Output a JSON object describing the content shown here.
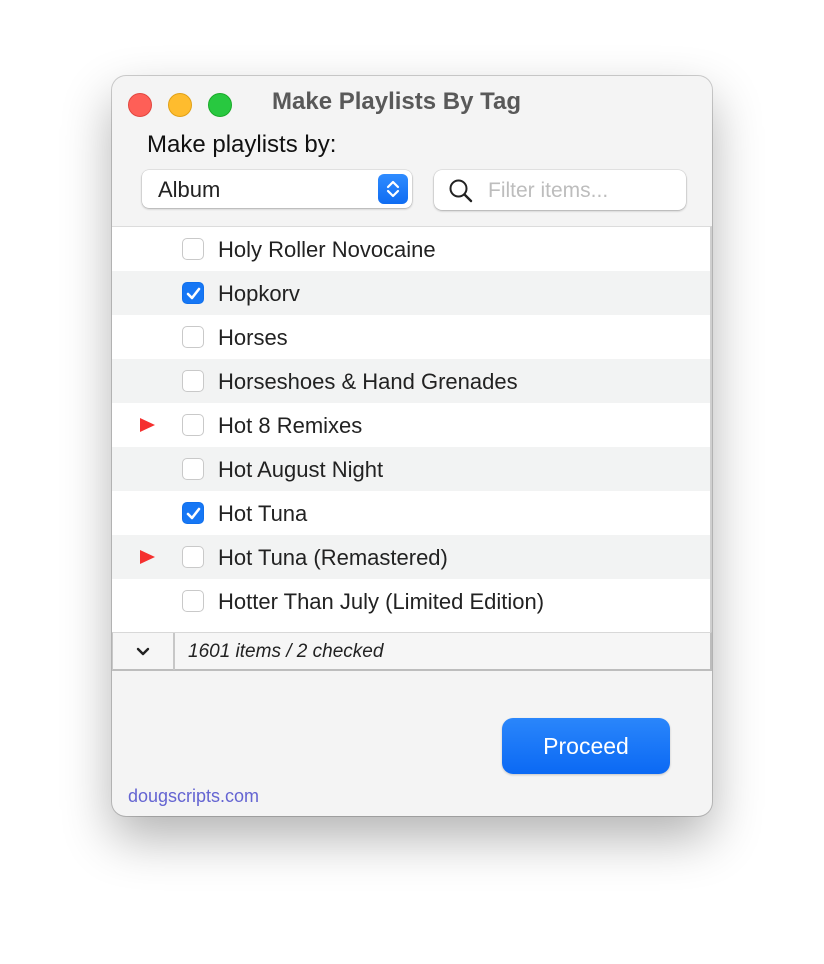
{
  "window": {
    "title": "Make Playlists By Tag"
  },
  "controls": {
    "label": "Make playlists by:",
    "popup_value": "Album",
    "search_placeholder": "Filter items...",
    "search_value": ""
  },
  "list": {
    "items": [
      {
        "name": "Holy Roller Novocaine",
        "checked": false,
        "flagged": false
      },
      {
        "name": "Hopkorv",
        "checked": true,
        "flagged": false
      },
      {
        "name": "Horses",
        "checked": false,
        "flagged": false
      },
      {
        "name": "Horseshoes & Hand Grenades",
        "checked": false,
        "flagged": false
      },
      {
        "name": "Hot 8 Remixes",
        "checked": false,
        "flagged": true
      },
      {
        "name": "Hot August Night",
        "checked": false,
        "flagged": false
      },
      {
        "name": "Hot Tuna",
        "checked": true,
        "flagged": false
      },
      {
        "name": "Hot Tuna (Remastered)",
        "checked": false,
        "flagged": true
      },
      {
        "name": "Hotter Than July (Limited Edition)",
        "checked": false,
        "flagged": false
      }
    ]
  },
  "status": {
    "text": "1601 items / 2 checked"
  },
  "footer": {
    "proceed_label": "Proceed",
    "link_text": "dougscripts.com"
  },
  "colors": {
    "accent": "#1677f5",
    "flag": "#f5302f",
    "link": "#6464d2"
  }
}
